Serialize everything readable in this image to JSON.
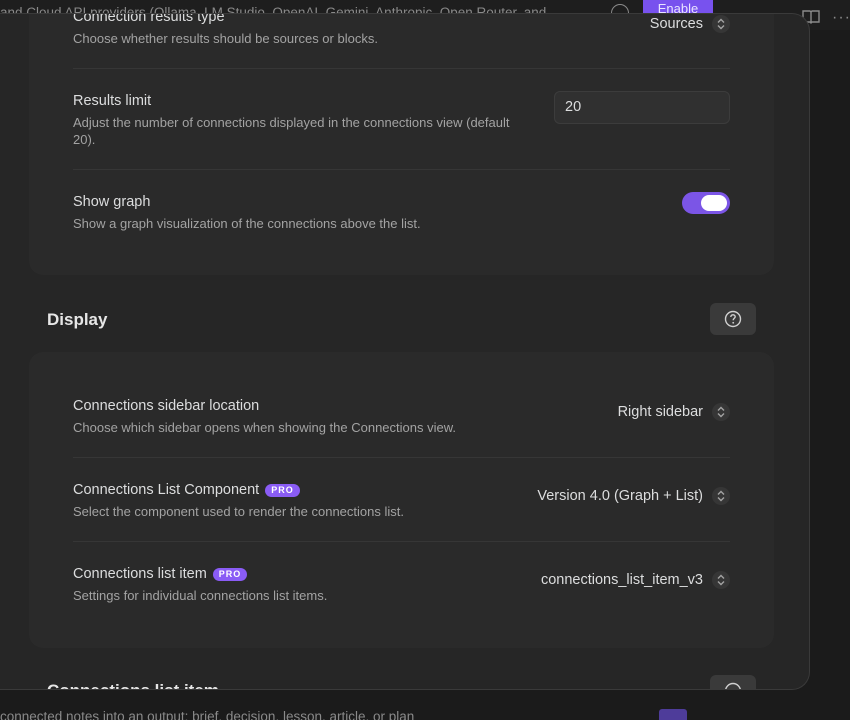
{
  "background": {
    "top_text": "and Cloud API providers (Ollama, LM Studio, OpenAI, Gemini, Anthropic, Open Router, and",
    "enable_label": "Enable",
    "bottom_text": "connected notes into an output: brief, decision, lesson, article, or plan"
  },
  "connections_group": {
    "results_type": {
      "name": "Connection results type",
      "description": "Choose whether results should be sources or blocks.",
      "value": "Sources"
    },
    "results_limit": {
      "name": "Results limit",
      "description": "Adjust the number of connections displayed in the connections view (default 20).",
      "value": "20"
    },
    "show_graph": {
      "name": "Show graph",
      "description": "Show a graph visualization of the connections above the list.",
      "enabled": true
    }
  },
  "display": {
    "heading": "Display",
    "sidebar_location": {
      "name": "Connections sidebar location",
      "description": "Choose which sidebar opens when showing the Connections view.",
      "value": "Right sidebar"
    },
    "list_component": {
      "name": "Connections List Component",
      "badge": "PRO",
      "description": "Select the component used to render the connections list.",
      "value": "Version 4.0 (Graph + List)"
    },
    "list_item": {
      "name": "Connections list item",
      "badge": "PRO",
      "description": "Settings for individual connections list items.",
      "value": "connections_list_item_v3"
    }
  },
  "next_section": {
    "heading": "Connections list item"
  },
  "colors": {
    "accent": "#7b55e6",
    "badge": "#8a5cf5"
  }
}
